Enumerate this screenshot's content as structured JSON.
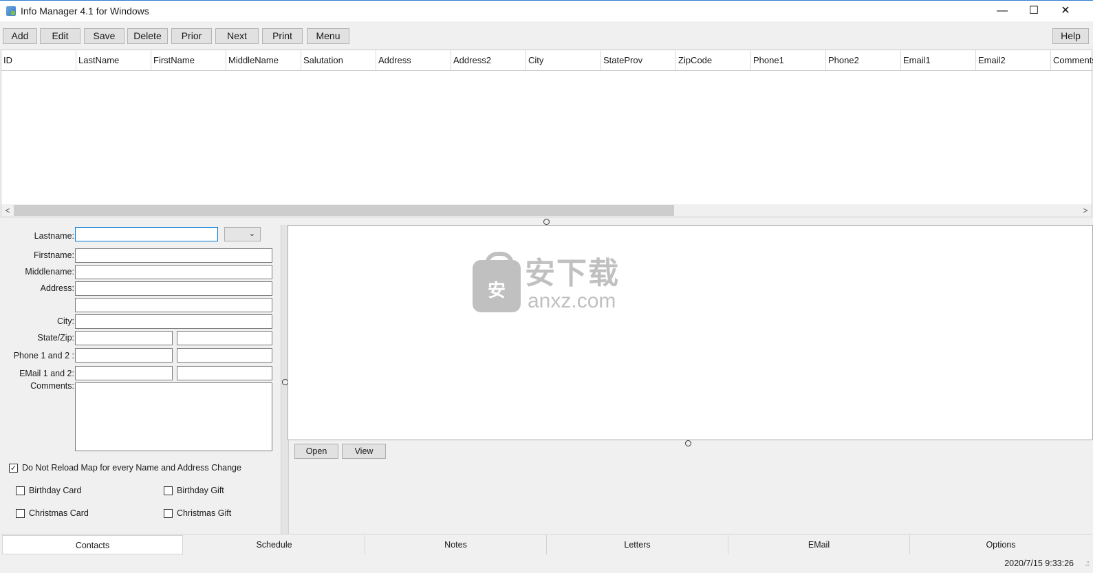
{
  "window": {
    "title": "Info Manager 4.1 for Windows",
    "minimize": "—",
    "maximize": "☐",
    "close": "✕"
  },
  "toolbar": {
    "add": "Add",
    "edit": "Edit",
    "save": "Save",
    "delete": "Delete",
    "prior": "Prior",
    "next": "Next",
    "print": "Print",
    "menu": "Menu",
    "help": "Help"
  },
  "grid": {
    "columns": [
      "ID",
      "LastName",
      "FirstName",
      "MiddleName",
      "Salutation",
      "Address",
      "Address2",
      "City",
      "StateProv",
      "ZipCode",
      "Phone1",
      "Phone2",
      "Email1",
      "Email2",
      "Comments"
    ],
    "scroll_left": "<",
    "scroll_right": ">"
  },
  "form": {
    "lastname_label": "Lastname:",
    "firstname_label": "Firstname:",
    "middlename_label": "Middlename:",
    "address_label": "Address:",
    "city_label": "City:",
    "statezip_label": "State/Zip:",
    "phone_label": "Phone 1 and 2 :",
    "email_label": "EMail 1 and 2:",
    "comments_label": "Comments:",
    "lastname_value": "",
    "dropdown_chevron": "⌄"
  },
  "options": {
    "no_reload_map": "Do Not Reload Map for every Name and Address Change",
    "no_reload_map_checked": "✓",
    "birthday_card": "Birthday Card",
    "birthday_gift": "Birthday Gift",
    "christmas_card": "Christmas Card",
    "christmas_gift": "Christmas Gift"
  },
  "map": {
    "watermark_cn": "安下载",
    "watermark_url": "anxz.com",
    "watermark_bag": "安",
    "open": "Open",
    "view": "View"
  },
  "tabs": [
    "Contacts",
    "Schedule",
    "Notes",
    "Letters",
    "EMail",
    "Options"
  ],
  "status": {
    "datetime": "2020/7/15 9:33:26",
    "grip": ".::"
  }
}
